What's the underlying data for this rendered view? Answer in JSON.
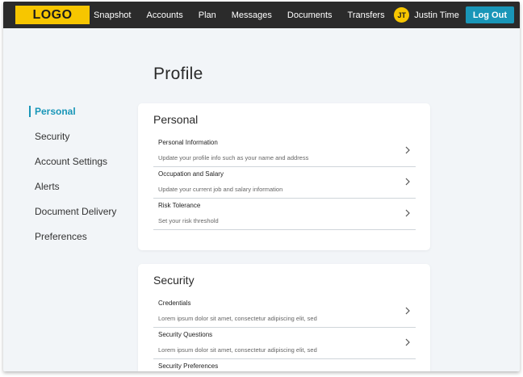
{
  "header": {
    "logo": "LOGO",
    "nav": [
      "Snapshot",
      "Accounts",
      "Plan",
      "Messages",
      "Documents",
      "Transfers"
    ],
    "user_initials": "JT",
    "user_name": "Justin Time",
    "logout_label": "Log Out"
  },
  "page": {
    "title": "Profile"
  },
  "sidebar": {
    "items": [
      {
        "label": "Personal",
        "active": true
      },
      {
        "label": "Security"
      },
      {
        "label": "Account Settings"
      },
      {
        "label": "Alerts"
      },
      {
        "label": "Document Delivery"
      },
      {
        "label": "Preferences"
      }
    ]
  },
  "cards": {
    "personal": {
      "title": "Personal",
      "rows": [
        {
          "title": "Personal Information",
          "desc": "Update your profile info such as your name and address"
        },
        {
          "title": "Occupation and Salary",
          "desc": "Update your current job and salary information"
        },
        {
          "title": "Risk Tolerance",
          "desc": "Set your risk threshold"
        }
      ]
    },
    "security": {
      "title": "Security",
      "rows": [
        {
          "title": "Credentials",
          "desc": "Lorem ipsum dolor sit amet, consectetur adipiscing elit, sed"
        },
        {
          "title": "Security Questions",
          "desc": "Lorem ipsum dolor sit amet, consectetur adipiscing elit, sed"
        },
        {
          "title": "Security Preferences",
          "desc": ""
        }
      ]
    }
  },
  "colors": {
    "accent": "#1996b8",
    "brand": "#f7c600",
    "header_bg": "#2b2b2b",
    "page_bg": "#f2f5f8"
  }
}
